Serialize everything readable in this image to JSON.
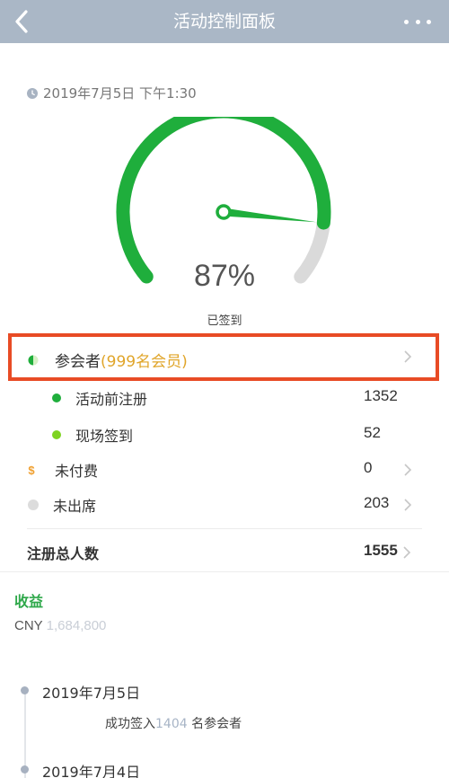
{
  "header": {
    "title": "活动控制面板",
    "back_icon": "chevron-left-icon",
    "more_icon": "more-dots-icon"
  },
  "event": {
    "datetime": "2019年7月5日 下午1:30"
  },
  "gauge": {
    "percent_text": "87%",
    "percent": 87,
    "caption": "已签到",
    "color_filled": "#1fae3c",
    "color_remaining": "#dadada"
  },
  "attendees": {
    "label": "参会者",
    "highlight": "(999名会员)",
    "highlight_color": "#e0a52a"
  },
  "stats": [
    {
      "label": "活动前注册",
      "value": "1352",
      "dot_color": "#1fae3c",
      "has_chevron": false
    },
    {
      "label": "现场签到",
      "value": "52",
      "dot_color": "#7ed321",
      "has_chevron": false
    },
    {
      "label": "未付费",
      "value": "0",
      "icon": "dollar-icon",
      "icon_color": "#f0a030",
      "has_chevron": true
    },
    {
      "label": "未出席",
      "value": "203",
      "dot_color": "#dcdcdc",
      "has_chevron": true
    }
  ],
  "total": {
    "label": "注册总人数",
    "value": "1555"
  },
  "revenue": {
    "title": "收益",
    "currency": "CNY",
    "amount": "1,684,800"
  },
  "timeline": [
    {
      "date": "2019年7月5日",
      "text_before": "成功签入",
      "count": "1404",
      "text_after": "名参会者"
    },
    {
      "date": "2019年7月4日"
    }
  ]
}
